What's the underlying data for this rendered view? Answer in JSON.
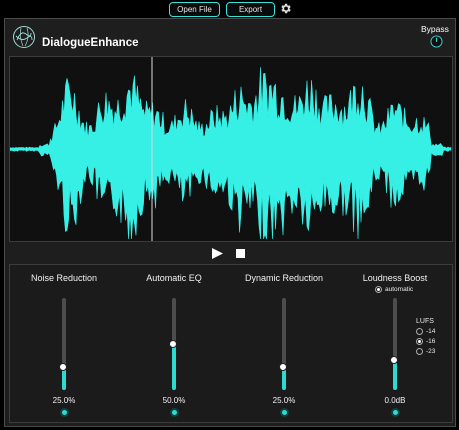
{
  "toolbar": {
    "open_label": "Open File",
    "export_label": "Export",
    "settings_icon": "gear-icon"
  },
  "app": {
    "title": "DialogueEnhance",
    "logo_icon": "globe-logo",
    "bypass_label": "Bypass"
  },
  "transport": {
    "play_icon": "play-icon",
    "stop_icon": "stop-icon"
  },
  "controls": [
    {
      "title": "Noise Reduction",
      "value_label": "25.0%",
      "level": 0.25
    },
    {
      "title": "Automatic EQ",
      "value_label": "50.0%",
      "level": 0.5
    },
    {
      "title": "Dynamic Reduction",
      "value_label": "25.0%",
      "level": 0.25
    },
    {
      "title": "Loudness Boost",
      "value_label": "0.0dB",
      "level": 0.33
    }
  ],
  "loudness": {
    "mode_label": "automatic",
    "lufs_label": "LUFS",
    "options": [
      "-14",
      "-16",
      "-23"
    ],
    "selected": "-16"
  },
  "colors": {
    "accent": "#2fd9d0",
    "waveform": "#36f0e6",
    "background": "#1e1e1e"
  }
}
